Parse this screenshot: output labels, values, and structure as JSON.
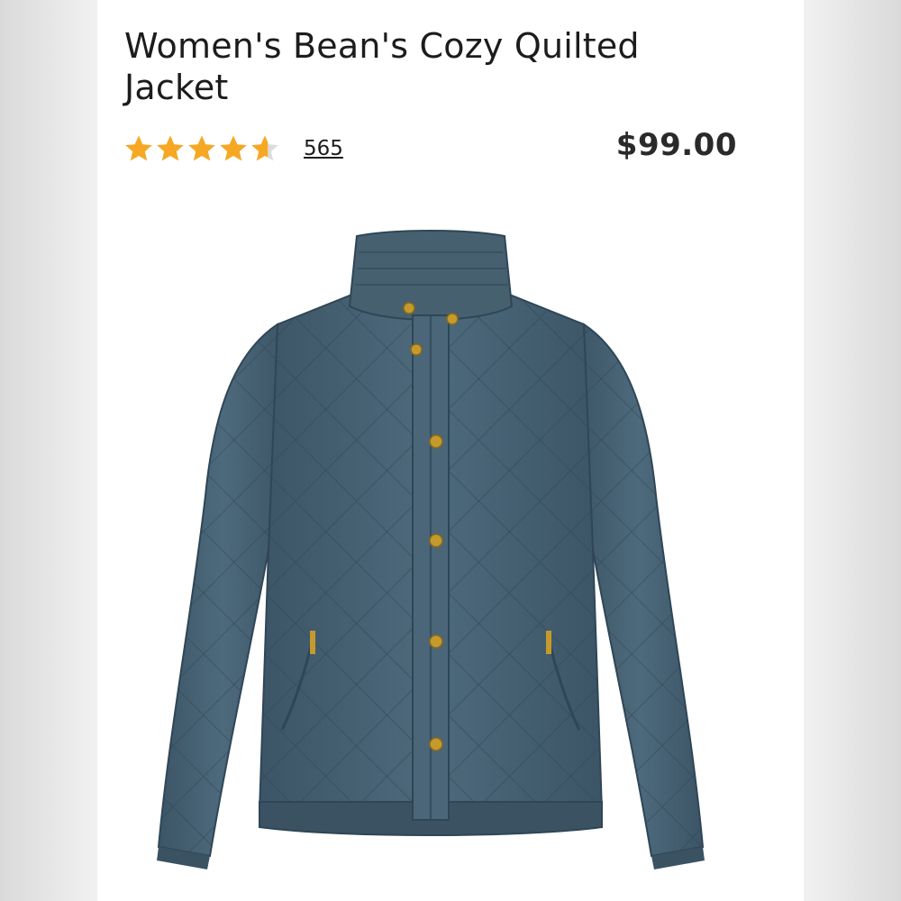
{
  "product": {
    "title": "Women's Bean's Cozy Quilted Jacket",
    "rating": {
      "value": 4.6,
      "max": 5,
      "count_label": "565",
      "star_color": "#f7a823",
      "empty_star_color": "#dcdcdc"
    },
    "price": "$99.00",
    "image": {
      "icon": "jacket-product-image",
      "color": "#466274",
      "button_color": "#c49a2c"
    }
  }
}
